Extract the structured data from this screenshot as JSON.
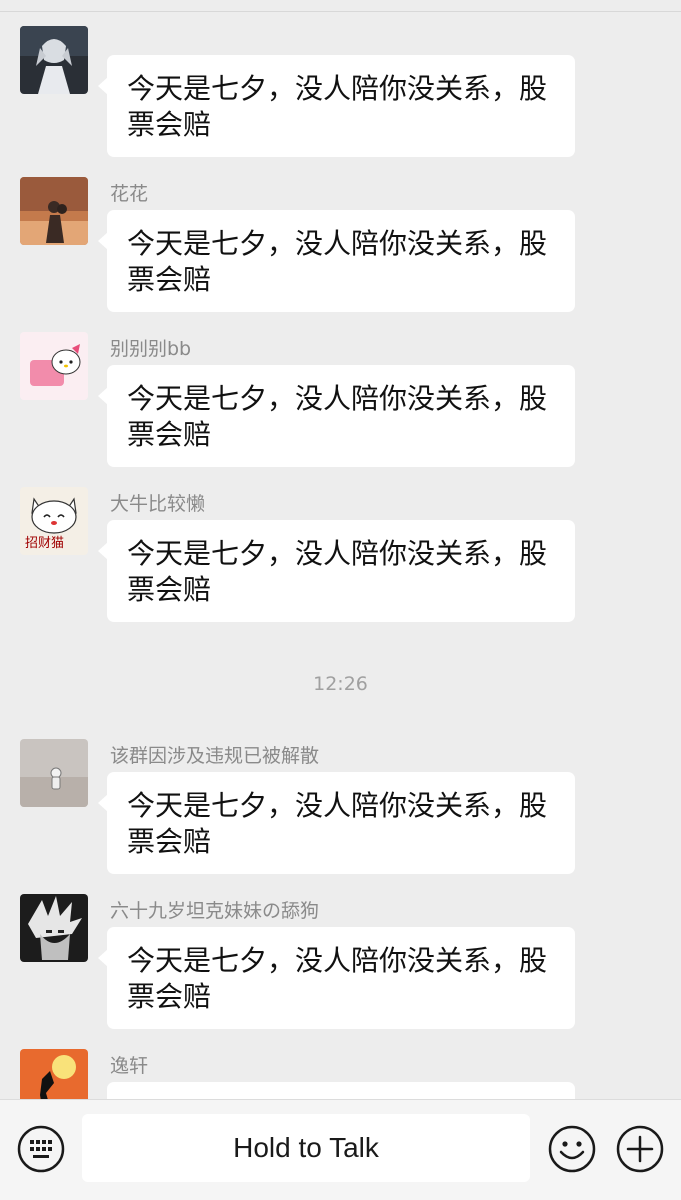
{
  "messages": [
    {
      "sender": "",
      "line1": "今天是七夕，没人陪你没关系，股",
      "line2": "票会赔"
    },
    {
      "sender": "花花",
      "line1": "今天是七夕，没人陪你没关系，股",
      "line2": "票会赔"
    },
    {
      "sender": "别别别bb",
      "line1": "今天是七夕，没人陪你没关系，股",
      "line2": "票会赔"
    },
    {
      "sender": "大牛比较懒",
      "line1": "今天是七夕，没人陪你没关系，股",
      "line2": "票会赔"
    },
    {
      "sender": "该群因涉及违规已被解散",
      "line1": "今天是七夕，没人陪你没关系，股",
      "line2": "票会赔"
    },
    {
      "sender": "六十九岁坦克妹妹の舔狗",
      "line1": "今天是七夕，没人陪你没关系，股",
      "line2": "票会赔"
    },
    {
      "sender": "逸轩",
      "line1": "",
      "line2": ""
    }
  ],
  "timestamp": "12:26",
  "input_bar": {
    "hold_to_talk_label": "Hold to Talk",
    "left_icon": "keyboard-icon",
    "emoji_icon": "emoji-icon",
    "plus_icon": "plus-icon"
  },
  "avatar_sticker_text": {
    "cat_avatar": "招财猫"
  }
}
